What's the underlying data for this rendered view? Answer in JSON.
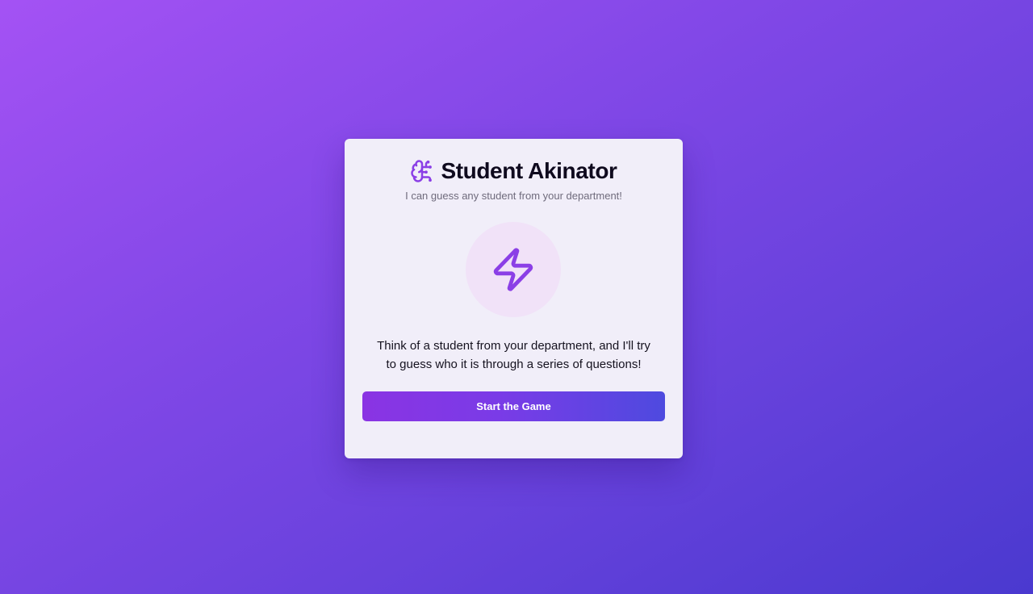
{
  "colors": {
    "accent": "#8b3fe6",
    "title_text": "#0f0a1e",
    "subtitle_text": "#6f6b7c",
    "button_gradient_start": "#8a34e3",
    "button_gradient_end": "#4e4adf",
    "button_text": "#ffffff"
  },
  "card": {
    "title_icon": "brain-icon",
    "title": "Student Akinator",
    "subtitle": "I can guess any student from your department!",
    "hero_icon": "lightning-bolt-icon",
    "description_line1": "Think of a student from your department, and I'll try",
    "description_line2": "to guess who it is through a series of questions!",
    "start_button_label": "Start the Game"
  }
}
